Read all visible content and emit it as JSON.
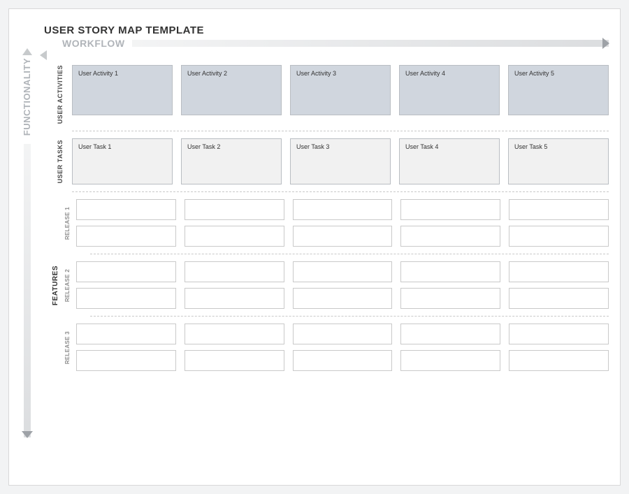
{
  "title": "USER STORY MAP TEMPLATE",
  "axes": {
    "workflow": "WORKFLOW",
    "functionality": "FUNCTIONALITY"
  },
  "bands": {
    "user_activities": {
      "label": "USER\nACTIVITIES",
      "cards": [
        "User Activity 1",
        "User Activity 2",
        "User Activity 3",
        "User Activity 4",
        "User Activity 5"
      ]
    },
    "user_tasks": {
      "label": "USER\nTASKS",
      "cards": [
        "User Task 1",
        "User Task 2",
        "User Task 3",
        "User Task 4",
        "User Task 5"
      ]
    }
  },
  "features": {
    "label": "FEATURES",
    "releases": [
      {
        "label": "RELEASE 1",
        "rows": [
          [
            "",
            "",
            "",
            "",
            ""
          ],
          [
            "",
            "",
            "",
            "",
            ""
          ]
        ]
      },
      {
        "label": "RELEASE 2",
        "rows": [
          [
            "",
            "",
            "",
            "",
            ""
          ],
          [
            "",
            "",
            "",
            "",
            ""
          ]
        ]
      },
      {
        "label": "RELEASE 3",
        "rows": [
          [
            "",
            "",
            "",
            "",
            ""
          ],
          [
            "",
            "",
            "",
            "",
            ""
          ]
        ]
      }
    ]
  }
}
